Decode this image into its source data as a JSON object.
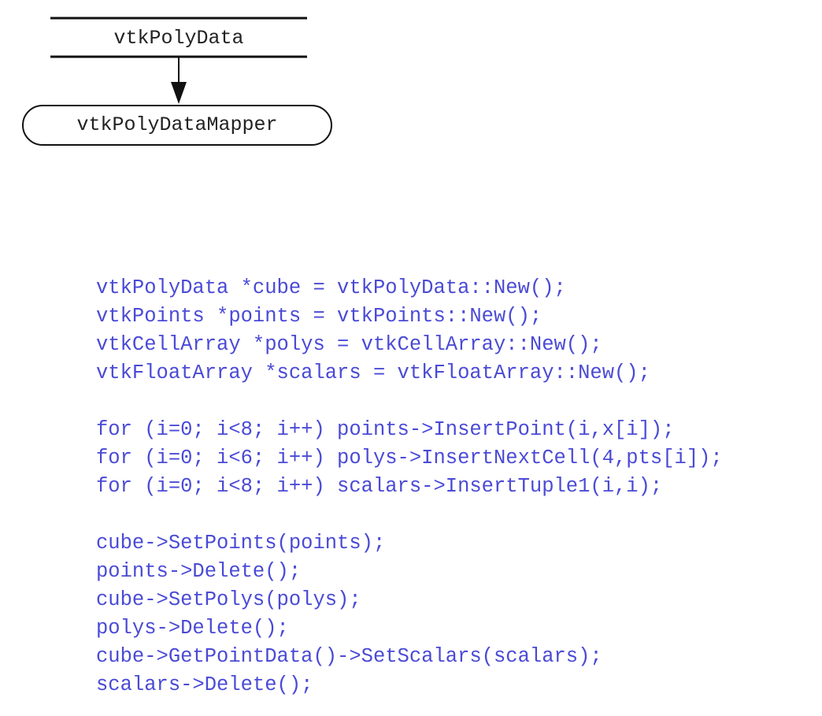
{
  "diagram": {
    "data_store_label": "vtkPolyData",
    "mapper_label": "vtkPolyDataMapper"
  },
  "code": {
    "line_1": "vtkPolyData *cube = vtkPolyData::New();",
    "line_2": "vtkPoints *points = vtkPoints::New();",
    "line_3": "vtkCellArray *polys = vtkCellArray::New();",
    "line_4": "vtkFloatArray *scalars = vtkFloatArray::New();",
    "line_5": "for (i=0; i<8; i++) points->InsertPoint(i,x[i]);",
    "line_6": "for (i=0; i<6; i++) polys->InsertNextCell(4,pts[i]);",
    "line_7": "for (i=0; i<8; i++) scalars->InsertTuple1(i,i);",
    "line_8": "cube->SetPoints(points);",
    "line_9": "points->Delete();",
    "line_10": "cube->SetPolys(polys);",
    "line_11": "polys->Delete();",
    "line_12": "cube->GetPointData()->SetScalars(scalars);",
    "line_13": "scalars->Delete();"
  },
  "colors": {
    "code_text": "#4a4ad6",
    "diagram_stroke": "#111111"
  }
}
